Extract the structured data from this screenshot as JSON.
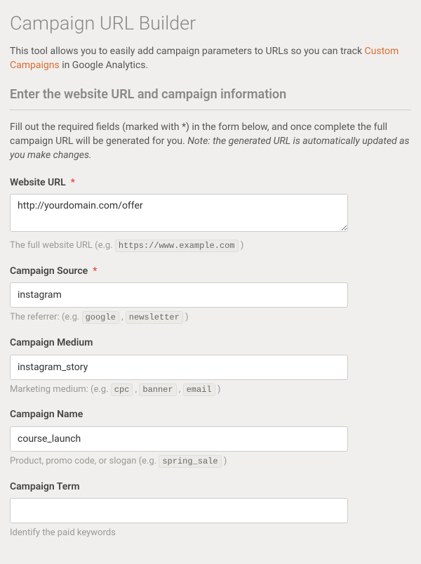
{
  "page": {
    "title": "Campaign URL Builder",
    "intro_prefix": "This tool allows you to easily add campaign parameters to URLs so you can track ",
    "intro_link": "Custom Campaigns",
    "intro_suffix": " in Google Analytics.",
    "section_heading": "Enter the website URL and campaign information",
    "desc_prefix": "Fill out the required fields (marked with *) in the form below, and once complete the full campaign URL will be generated for you. ",
    "desc_note": "Note: the generated URL is automatically updated as you make changes."
  },
  "required_star": "*",
  "fields": {
    "url": {
      "label": "Website URL",
      "required": true,
      "value": "http://yourdomain.com/offer",
      "help_prefix": "The full website URL (e.g. ",
      "help_code1": "https://www.example.com",
      "help_suffix": " )"
    },
    "source": {
      "label": "Campaign Source",
      "required": true,
      "value": "instagram",
      "help_prefix": "The referrer: (e.g. ",
      "help_code1": "google",
      "help_sep": " , ",
      "help_code2": "newsletter",
      "help_suffix": " )"
    },
    "medium": {
      "label": "Campaign Medium",
      "required": false,
      "value": "instagram_story",
      "help_prefix": "Marketing medium: (e.g. ",
      "help_code1": "cpc",
      "help_sep": " , ",
      "help_code2": "banner",
      "help_sep2": " , ",
      "help_code3": "email",
      "help_suffix": " )"
    },
    "name": {
      "label": "Campaign Name",
      "required": false,
      "value": "course_launch",
      "help_prefix": "Product, promo code, or slogan (e.g. ",
      "help_code1": "spring_sale",
      "help_suffix": " )"
    },
    "term": {
      "label": "Campaign Term",
      "required": false,
      "value": "",
      "help_text": "Identify the paid keywords"
    }
  }
}
